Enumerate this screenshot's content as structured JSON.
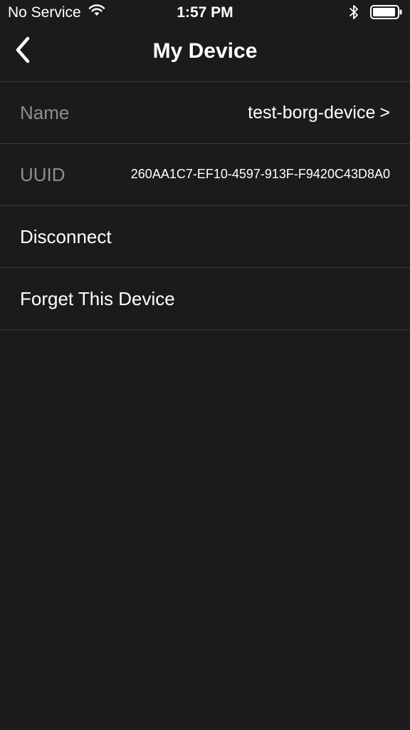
{
  "status_bar": {
    "carrier": "No Service",
    "time": "1:57 PM",
    "wifi_icon": "wifi-icon",
    "bluetooth_icon": "bluetooth-icon",
    "battery_icon": "battery-icon"
  },
  "nav": {
    "back_icon": "chevron-left-icon",
    "title": "My Device"
  },
  "rows": {
    "name": {
      "label": "Name",
      "value": "test-borg-device",
      "chevron": ">"
    },
    "uuid": {
      "label": "UUID",
      "value": "260AA1C7-EF10-4597-913F-F9420C43D8A0"
    },
    "disconnect": {
      "label": "Disconnect"
    },
    "forget": {
      "label": "Forget This Device"
    }
  },
  "colors": {
    "background": "#1b1b1b",
    "separator": "#3b3b3b",
    "muted_label": "#8e8e8e",
    "text": "#ffffff"
  }
}
